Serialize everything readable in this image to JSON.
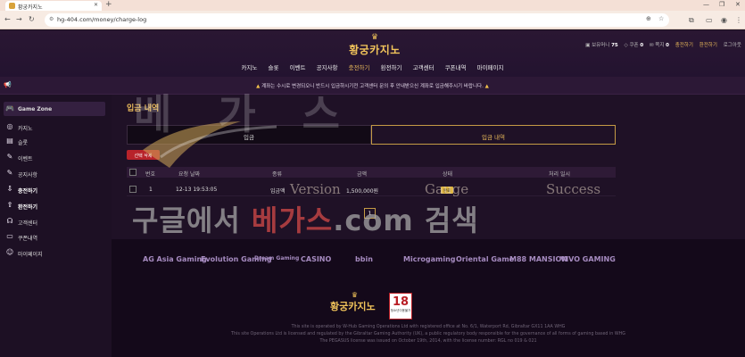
{
  "browser": {
    "tab_title": "황궁카지노",
    "url": "hg-404.com/money/charge-log"
  },
  "site": {
    "logo_text": "황궁카지노",
    "user": {
      "points_label": "보유머니",
      "points_value": "75",
      "coupon_label": "쿠폰",
      "coupon_value": "0",
      "msg_label": "쪽지",
      "msg_value": "0",
      "charge_label": "충전하기",
      "withdraw_label": "환전하기",
      "logout_label": "로그아웃"
    },
    "nav": [
      "카지노",
      "슬롯",
      "이벤트",
      "공지사항",
      "충전하기",
      "환전하기",
      "고객센터",
      "쿠폰내역",
      "마이페이지"
    ],
    "notice": "계좌는 수시로 변경되오니 반드시 입금하시기전 고객센터 문의 후 안내받으신 계좌로 입금해주시기 바랍니다."
  },
  "sidebar": {
    "items": [
      {
        "label": "Game Zone",
        "icon": "gamepad-icon"
      },
      {
        "label": "카지노",
        "icon": "chip-icon"
      },
      {
        "label": "슬롯",
        "icon": "slot-icon"
      },
      {
        "label": "이벤트",
        "icon": "pencil-icon"
      },
      {
        "label": "공지사항",
        "icon": "pencil-icon"
      },
      {
        "label": "충전하기",
        "icon": "deposit-icon"
      },
      {
        "label": "환전하기",
        "icon": "withdraw-icon"
      },
      {
        "label": "고객센터",
        "icon": "headset-icon"
      },
      {
        "label": "쿠폰내역",
        "icon": "coupon-icon"
      },
      {
        "label": "마이페이지",
        "icon": "user-icon"
      }
    ]
  },
  "main": {
    "title": "입금 내역",
    "tabs": [
      "입금",
      "입금 내역"
    ],
    "select_delete": "선택 삭제",
    "columns": [
      "번호",
      "요청 날짜",
      "종류",
      "금액",
      "상태",
      "처리 일시"
    ],
    "rows": [
      {
        "no": "1",
        "date": "12-13 19:53:05",
        "type": "입금액",
        "amount": "1,500,000원",
        "status": "완료",
        "processed": ""
      }
    ],
    "page": "1"
  },
  "watermarks": {
    "title": "베 가 스",
    "version": "Version",
    "gauge": "Gauge",
    "success": "Success",
    "search_prefix": "구글에서",
    "search_brand": "베가스",
    "search_suffix": ".com 검색"
  },
  "footer": {
    "providers": [
      "AG Asia Gaming",
      "Evolution Gaming",
      "Dream Gaming",
      "CASINO",
      "bbin",
      "Microgaming",
      "Oriental Game",
      "M88 MANSION",
      "VIVO GAMING"
    ],
    "logo_text": "황궁카지노",
    "age_badge": "18",
    "age_caption": "청소년이용불가",
    "legal": [
      "This site is operated by W-Hub Gaming Operations Ltd with registered office at No. 6/1, Waterport Rd, Gibraltar GX11 1AA WHG",
      "This site Operations Ltd is licensed and regulated by the Gibraltar Gaming Authority (UK), a public regulatory body responsible for the governance of all forms of gaming based in WHG",
      "The PEGASUS license was issued on October 19th, 2014, with the license number: RGL no 019 & 021"
    ]
  }
}
